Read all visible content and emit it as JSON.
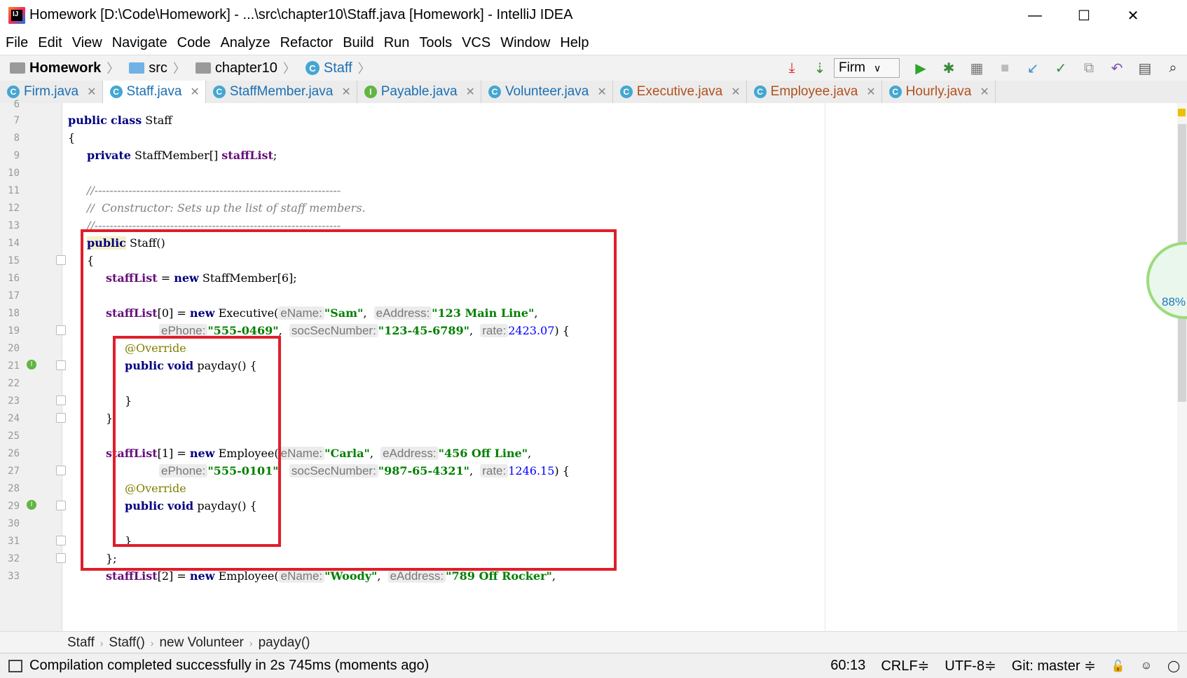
{
  "window": {
    "title": "Homework [D:\\Code\\Homework] - ...\\src\\chapter10\\Staff.java [Homework] - IntelliJ IDEA",
    "minimize": "—",
    "maximize": "☐",
    "close": "✕"
  },
  "menu": [
    "File",
    "Edit",
    "View",
    "Navigate",
    "Code",
    "Analyze",
    "Refactor",
    "Build",
    "Run",
    "Tools",
    "VCS",
    "Window",
    "Help"
  ],
  "breadcrumb_nav": {
    "project": "Homework",
    "src": "src",
    "package": "chapter10",
    "class": "Staff"
  },
  "toolbar": {
    "run_config": "Firm"
  },
  "tabs": [
    {
      "label": "Firm.java",
      "icon": "C"
    },
    {
      "label": "Staff.java",
      "icon": "C",
      "active": true
    },
    {
      "label": "StaffMember.java",
      "icon": "C"
    },
    {
      "label": "Payable.java",
      "icon": "I"
    },
    {
      "label": "Volunteer.java",
      "icon": "C"
    },
    {
      "label": "Executive.java",
      "icon": "C"
    },
    {
      "label": "Employee.java",
      "icon": "C"
    },
    {
      "label": "Hourly.java",
      "icon": "C"
    }
  ],
  "line_numbers": [
    "6",
    "7",
    "8",
    "9",
    "10",
    "11",
    "12",
    "13",
    "14",
    "15",
    "16",
    "17",
    "18",
    "19",
    "20",
    "21",
    "22",
    "23",
    "24",
    "25",
    "26",
    "27",
    "28",
    "29",
    "30",
    "31",
    "32",
    "33"
  ],
  "code": {
    "public": "public",
    "class": "class",
    "private": "private",
    "new": "new",
    "void": "void",
    "staff_cls": "Staff",
    "brace_open": "{",
    "brace_close": "}",
    "brace_close_semi": "};",
    "staff_member_type": "StaffMember[]",
    "staff_list": "staffList",
    "semi": ";",
    "comment_rule": "//-----------------------------------------------------------------",
    "comment_ctor": "//  Constructor: Sets up the list of staff members.",
    "ctor_name": "Staff()",
    "assign_new_array": " = ",
    "array_init": "StaffMember[6];",
    "idx0": "[0] = ",
    "idx1": "[1] = ",
    "idx2": "[2] = ",
    "executive_call": "Executive(",
    "employee_call": "Employee(",
    "hint_ename": "eName:",
    "hint_eaddress": "eAddress:",
    "hint_ephone": "ePhone:",
    "hint_ssn": "socSecNumber:",
    "hint_rate": "rate:",
    "sam": "\"Sam\"",
    "addr_sam": "\"123 Main Line\"",
    "phone_sam": "\"555-0469\"",
    "ssn_sam": "\"123-45-6789\"",
    "rate_sam": "2423.07",
    "carla": "\"Carla\"",
    "addr_carla": "\"456 Off Line\"",
    "phone_carla": "\"555-0101\"",
    "ssn_carla": "\"987-65-4321\"",
    "rate_carla": "1246.15",
    "woody": "\"Woody\"",
    "addr_woody": "\"789 Off Rocker\"",
    "comma": ",",
    "close_brace_call": ") {",
    "override": "@Override",
    "payday": "payday() {"
  },
  "widget": {
    "percent": "88%"
  },
  "editor_breadcrumb": [
    "Staff",
    "Staff()",
    "new Volunteer",
    "payday()"
  ],
  "status": {
    "message": "Compilation completed successfully in 2s 745ms (moments ago)",
    "position": "60:13",
    "line_sep": "CRLF≑",
    "encoding": "UTF-8≑",
    "vcs": "Git: master ≑"
  }
}
